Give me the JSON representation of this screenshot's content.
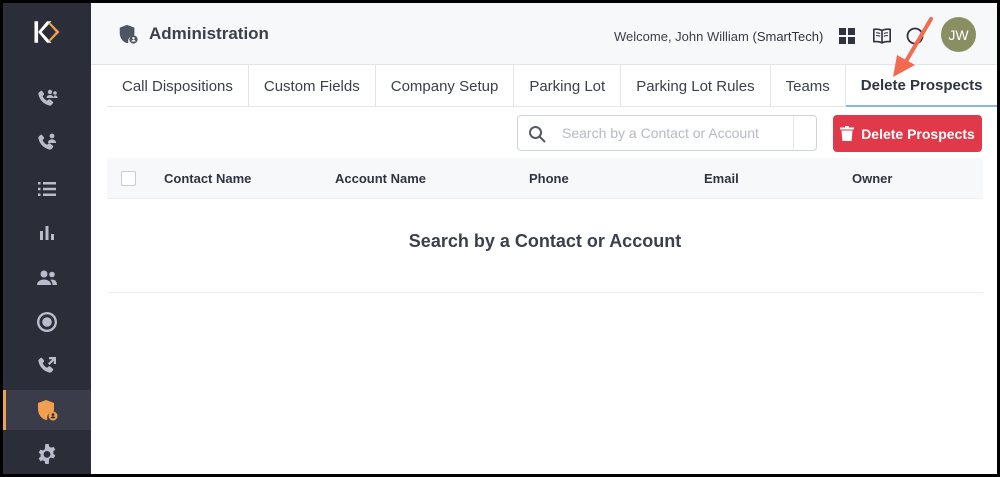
{
  "header": {
    "title": "Administration",
    "welcome": "Welcome, John William",
    "org": "(SmartTech)",
    "avatar_initials": "JW"
  },
  "sidebar": {
    "items": [
      {
        "icon": "call-group-icon"
      },
      {
        "icon": "call-user-icon"
      },
      {
        "icon": "list-icon"
      },
      {
        "icon": "bar-chart-icon"
      },
      {
        "icon": "users-icon"
      },
      {
        "icon": "record-icon"
      },
      {
        "icon": "call-transfer-icon"
      },
      {
        "icon": "admin-shield-icon",
        "active": true
      },
      {
        "icon": "gear-icon"
      }
    ]
  },
  "tabs": [
    {
      "label": "Call Dispositions"
    },
    {
      "label": "Custom Fields"
    },
    {
      "label": "Company Setup"
    },
    {
      "label": "Parking Lot"
    },
    {
      "label": "Parking Lot Rules"
    },
    {
      "label": "Teams"
    },
    {
      "label": "Delete Prospects",
      "active": true
    }
  ],
  "search": {
    "placeholder": "Search by a Contact or Account",
    "value": ""
  },
  "delete_button": {
    "label": "Delete Prospects"
  },
  "table": {
    "columns": [
      "Contact Name",
      "Account Name",
      "Phone",
      "Email",
      "Owner"
    ],
    "empty_message": "Search by a Contact or Account"
  },
  "colors": {
    "sidebar_bg": "#2b2d38",
    "accent": "#f0a050",
    "danger": "#e03a4a",
    "annotation_arrow": "#f26b50",
    "avatar_bg": "#8a8f63"
  }
}
